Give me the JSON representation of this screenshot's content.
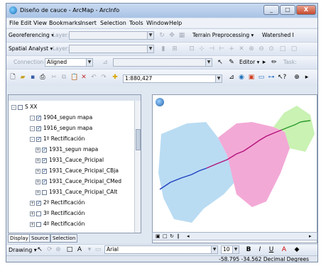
{
  "window": {
    "title": "Diseño de cauce - ArcMap - ArcInfo",
    "min_label": "_",
    "max_label": "□",
    "close_label": "X"
  },
  "menu": [
    "File",
    "Edit",
    "View",
    "Bookmarks",
    "Insert",
    "Selection",
    "Tools",
    "Window",
    "Help"
  ],
  "toolbar1": {
    "georeferencing_label": "Georeferencing ▾",
    "terrain_label": "Terrain Preprocessing ▾",
    "watershed_label": "Watershed I"
  },
  "toolbar2": {
    "spatial_analyst_label": "Spatial Analyst ▾",
    "layer_label": "Layer:"
  },
  "toolbar3": {
    "connection_label": "Connection",
    "aligned_value": "Aligned",
    "editor_label": "Editor ▾",
    "task_label": "Task:"
  },
  "toolbar4": {
    "scale_value": "1:880,427"
  },
  "toc": {
    "items": [
      {
        "label": "S XX",
        "level": 0,
        "exp": "-",
        "checked": false
      },
      {
        "label": "1904_segun mapa",
        "level": 1,
        "exp": "-",
        "checked": true
      },
      {
        "label": "1916_segun mapa",
        "level": 1,
        "exp": "-",
        "checked": true
      },
      {
        "label": "1º Rectificación",
        "level": 1,
        "exp": "-",
        "checked": true
      },
      {
        "label": "1931_segun mapa",
        "level": 2,
        "exp": "+",
        "checked": true
      },
      {
        "label": "1931_Cauce_Pricipal",
        "level": 2,
        "exp": "+",
        "checked": true
      },
      {
        "label": "1931_Cauce_Pricipal_CBja",
        "level": 2,
        "exp": "+",
        "checked": true
      },
      {
        "label": "1931_Cauce_Pricipal_CMed",
        "level": 2,
        "exp": "+",
        "checked": true
      },
      {
        "label": "1931_Cauce_Pricipal_CAlt",
        "level": 2,
        "exp": "+",
        "checked": false
      },
      {
        "label": "2º Rectificación",
        "level": 1,
        "exp": "+",
        "checked": true
      },
      {
        "label": "3º Rectificación",
        "level": 1,
        "exp": "+",
        "checked": false
      },
      {
        "label": "4º Rectificación",
        "level": 1,
        "exp": "+",
        "checked": false
      }
    ]
  },
  "toc_tabs": [
    "Display",
    "Source",
    "Selection"
  ],
  "drawing": {
    "drawing_label": "Drawing ▾",
    "font_value": "Arial",
    "size_value": "10",
    "bold": "B",
    "italic": "I",
    "underline": "U",
    "font_color": "A"
  },
  "status": {
    "coords": "-58.795  -34.562 Decimal Degrees"
  },
  "colors": {
    "blue_region": "#b9dcf3",
    "pink_region": "#f3a9d6",
    "green_region": "#c9f2b3",
    "river_blue": "#1f3fbf",
    "river_magenta": "#b3127a",
    "river_green": "#2a9a2a"
  }
}
